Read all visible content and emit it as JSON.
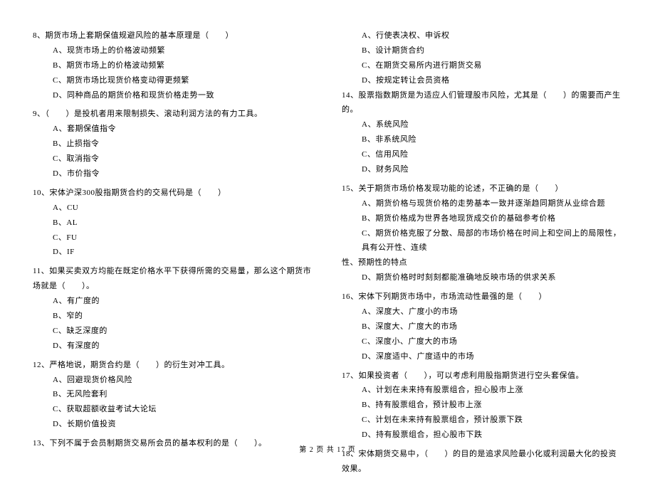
{
  "left_column": {
    "q8": {
      "text": "8、期货市场上套期保值规避风险的基本原理是（　　）",
      "options": [
        "A、现货市场上的价格波动频繁",
        "B、期货市场上的价格波动频繁",
        "C、期货市场比现货价格变动得更频繁",
        "D、同种商品的期货价格和现货价格走势一致"
      ]
    },
    "q9": {
      "text": "9、（　　）是投机者用来限制损失、滚动利润方法的有力工具。",
      "options": [
        "A、套期保值指令",
        "B、止损指令",
        "C、取消指令",
        "D、市价指令"
      ]
    },
    "q10": {
      "text": "10、宋体沪深300股指期货合约的交易代码是（　　）",
      "options": [
        "A、CU",
        "B、AL",
        "C、FU",
        "D、IF"
      ]
    },
    "q11": {
      "text": "11、如果买卖双方均能在既定价格水平下获得所需的交易量，那么这个期货市场就是（　　）。",
      "options": [
        "A、有广度的",
        "B、窄的",
        "C、缺乏深度的",
        "D、有深度的"
      ]
    },
    "q12": {
      "text": "12、严格地说，期货合约是（　　）的衍生对冲工具。",
      "options": [
        "A、回避现货价格风险",
        "B、无风险套利",
        "C、获取超额收益考试大论坛",
        "D、长期价值投资"
      ]
    },
    "q13": {
      "text": "13、下列不属于会员制期货交易所会员的基本权利的是（　　）。"
    }
  },
  "right_column": {
    "q13_options": [
      "A、行使表决权、申诉权",
      "B、设计期货合约",
      "C、在期货交易所内进行期货交易",
      "D、按规定转让会员资格"
    ],
    "q14": {
      "text": "14、股票指数期货是为适应人们管理股市风险，尤其是（　　）的需要而产生的。",
      "options": [
        "A、系统风险",
        "B、非系统风险",
        "C、信用风险",
        "D、财务风险"
      ]
    },
    "q15": {
      "text": "15、关于期货市场价格发现功能的论述，不正确的是（　　）",
      "options": [
        "A、期货价格与现货价格的走势基本一致并逐渐趋同期货从业综合题",
        "B、期货价格成为世界各地现货成交价的基础参考价格",
        "C、期货价格克服了分散、局部的市场价格在时间上和空间上的局限性，具有公开性、连续"
      ],
      "continuation": "性、预期性的特点",
      "option_d": "D、期货价格时时刻刻都能准确地反映市场的供求关系"
    },
    "q16": {
      "text": "16、宋体下列期货市场中，市场流动性最强的是（　　）",
      "options": [
        "A、深度大、广度小的市场",
        "B、深度大、广度大的市场",
        "C、深度小、广度大的市场",
        "D、深度适中、广度适中的市场"
      ]
    },
    "q17": {
      "text": "17、如果投资者（　　），可以考虑利用股指期货进行空头套保值。",
      "options": [
        "A、计划在未来持有股票组合，担心股市上涨",
        "B、持有股票组合，预计股市上涨",
        "C、计划在未来持有股票组合，预计股票下跌",
        "D、持有股票组合，担心股市下跌"
      ]
    },
    "q18": {
      "text": "18、宋体期货交易中，（　　）的目的是追求风险最小化或利润最大化的投资效果。"
    }
  },
  "footer": "第 2 页 共 17 页"
}
